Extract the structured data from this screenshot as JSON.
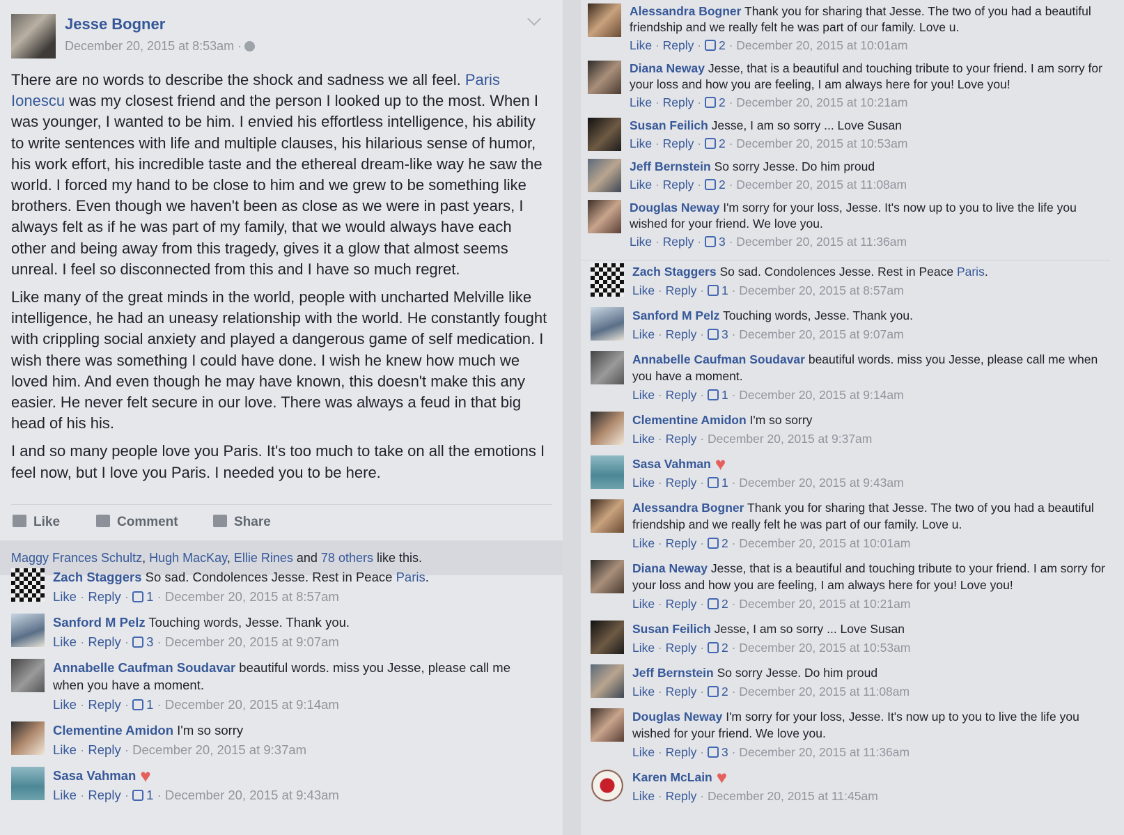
{
  "post": {
    "author": "Jesse Bogner",
    "time": "December 20, 2015 at 8:53am ·",
    "paragraphs": [
      {
        "before": "There are no words to describe the shock and sadness we all feel. ",
        "link": "Paris Ionescu",
        "after": " was my closest friend and the person I looked up to the most. When I was younger, I wanted to be him. I envied his effortless intelligence, his ability to write sentences with life and multiple clauses, his hilarious sense of humor, his work effort, his incredible taste and the ethereal dream-like way he saw the world. I forced my hand to be close to him and we grew to be something like brothers. Even though we haven't been as close as we were in past years, I always felt as if he was part of my family, that we would always have each other and being away from this tragedy, gives it a glow that almost seems unreal. I feel so disconnected from this and I have so much regret."
      },
      {
        "before": "Like many of the great minds in the world, people with uncharted Melville like intelligence, he had an uneasy relationship with the world. He constantly fought with crippling social anxiety and played a dangerous game of self medication. I wish there was something I could have done. I wish he knew how much we loved him. And even though he may have known, this doesn't make this any easier. He never felt secure in our love. There was always a feud in that big head of his his.",
        "link": "",
        "after": ""
      },
      {
        "before": "I and so many people love you Paris. It's too much to take on all the emotions I feel now, but I love you Paris. I needed you to be here.",
        "link": "",
        "after": ""
      }
    ],
    "actions": {
      "like": "Like",
      "comment": "Comment",
      "share": "Share"
    },
    "likes": {
      "name1": "Maggy Frances Schultz",
      "sep1": ", ",
      "name2": "Hugh MacKay",
      "sep2": ", ",
      "name3": "Ellie Rines",
      "and": " and ",
      "others": "78 others",
      "suffix": " like this."
    }
  },
  "comments": {
    "zach": {
      "name": "Zach Staggers",
      "text": " So sad. Condolences Jesse. Rest in Peace ",
      "link": "Paris",
      "tail": ".",
      "likes": "1",
      "time": " · December 20, 2015 at 8:57am"
    },
    "sanford": {
      "name": "Sanford M Pelz",
      "text": " Touching words, Jesse. Thank you.",
      "likes": "3",
      "time": " · December 20, 2015 at 9:07am"
    },
    "annabelle": {
      "name": "Annabelle Caufman Soudavar",
      "text": " beautiful words. miss you Jesse, please call me when you have a moment.",
      "likes": "1",
      "time": " · December 20, 2015 at 9:14am"
    },
    "clementine": {
      "name": "Clementine Amidon",
      "text": " I'm so sorry",
      "time": " · December 20, 2015 at 9:37am"
    },
    "sasa": {
      "name": "Sasa Vahman",
      "heart": "♥",
      "likes": "1",
      "time": " · December 20, 2015 at 9:43am"
    },
    "alessandra": {
      "name": "Alessandra Bogner",
      "text": " Thank you for sharing that Jesse. The two of you had a beautiful friendship and we really felt he was part of our family. Love u.",
      "likes": "2",
      "time": " · December 20, 2015 at 10:01am"
    },
    "diana": {
      "name": "Diana Neway",
      "text": " Jesse, that is a beautiful and touching tribute to your friend. I am sorry for your loss and how you are feeling, I am always here for you! Love you!",
      "likes": "2",
      "time": " · December 20, 2015 at 10:21am"
    },
    "susan": {
      "name": "Susan Feilich",
      "text": " Jesse, I am so sorry ... Love Susan",
      "likes": "2",
      "time": " · December 20, 2015 at 10:53am"
    },
    "jeff": {
      "name": "Jeff Bernstein",
      "text": " So sorry Jesse. Do him proud",
      "likes": "2",
      "time": " · December 20, 2015 at 11:08am"
    },
    "douglas": {
      "name": "Douglas Neway",
      "text": " I'm sorry for your loss, Jesse. It's now up to you to live the life you wished for your friend. We love you.",
      "likes": "3",
      "time": " · December 20, 2015 at 11:36am"
    },
    "karen": {
      "name": "Karen McLain",
      "heart": "♥",
      "time": " · December 20, 2015 at 11:45am"
    }
  },
  "labels": {
    "like": "Like",
    "dot": " · ",
    "reply": "Reply",
    "like_count_sep": " · "
  },
  "colors": {
    "link": "#365899",
    "meta": "#90949c",
    "heart": "#e4605c"
  }
}
